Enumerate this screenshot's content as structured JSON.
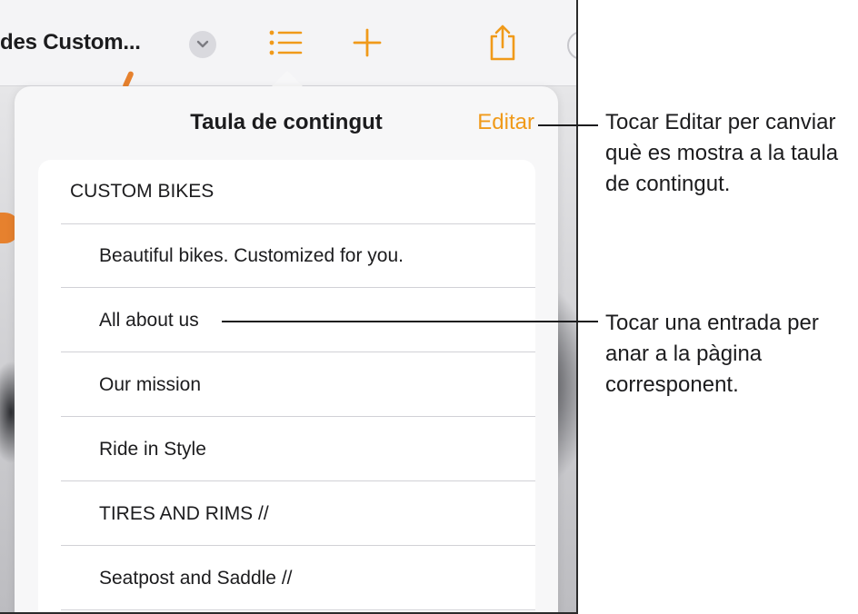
{
  "toolbar": {
    "doc_title": "des Custom...",
    "icons": [
      "chevron-down-icon",
      "list-icon",
      "plus-icon",
      "share-icon"
    ],
    "accent_color": "#f09a1a"
  },
  "popover": {
    "title": "Taula de contingut",
    "edit_label": "Editar",
    "items": [
      {
        "label": "CUSTOM  BIKES",
        "level": 0
      },
      {
        "label": "Beautiful bikes. Customized for you.",
        "level": 1
      },
      {
        "label": "All about us",
        "level": 1
      },
      {
        "label": "Our mission",
        "level": 1
      },
      {
        "label": "Ride in Style",
        "level": 1
      },
      {
        "label": "TIRES AND RIMS //",
        "level": 1
      },
      {
        "label": "Seatpost and Saddle //",
        "level": 1
      }
    ]
  },
  "callouts": {
    "edit": "Tocar Editar per canviar què es mostra a la taula de contingut.",
    "entry": "Tocar una entrada per anar a la pàgina corresponent."
  }
}
